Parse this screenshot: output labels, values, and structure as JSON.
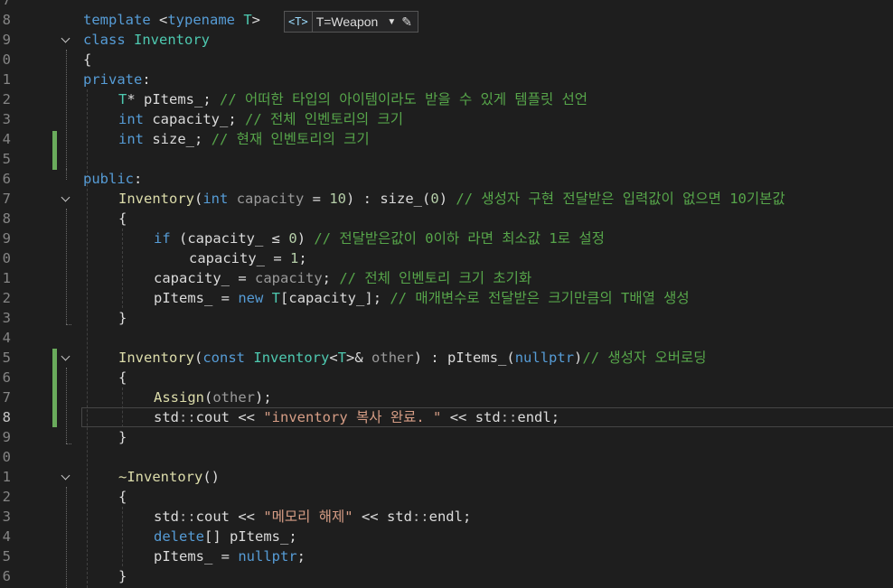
{
  "template_hint": {
    "tag": "<T>",
    "value": "T=Weapon",
    "dropdown_icon": "chevron-down-icon",
    "edit_icon": "pencil-icon"
  },
  "line_numbers": [
    "7",
    "8",
    "9",
    "0",
    "1",
    "2",
    "3",
    "4",
    "5",
    "6",
    "7",
    "8",
    "9",
    "0",
    "1",
    "2",
    "3",
    "4",
    "5",
    "6",
    "7",
    "8",
    "9",
    "0",
    "1",
    "2",
    "3",
    "4",
    "5",
    "6"
  ],
  "code": {
    "l8": [
      "template",
      " <",
      "typename",
      " ",
      "T",
      ">"
    ],
    "l9": [
      "class",
      " ",
      "Inventory"
    ],
    "l10": [
      "{"
    ],
    "l11": [
      "private",
      ":"
    ],
    "l12": [
      "T",
      "* ",
      "pItems_",
      "; ",
      "// 어떠한 타입의 아이템이라도 받을 수 있게 템플릿 선언"
    ],
    "l13": [
      "int",
      " ",
      "capacity_",
      "; ",
      "// 전체 인벤토리의 크기"
    ],
    "l14": [
      "int",
      " ",
      "size_",
      "; ",
      "// 현재 인벤토리의 크기"
    ],
    "l16": [
      "public",
      ":"
    ],
    "l17": [
      "Inventory",
      "(",
      "int",
      " ",
      "capacity",
      " = ",
      "10",
      ") : ",
      "size_",
      "(",
      "0",
      ") ",
      "// 생성자 구현 전달받은 입력값이 없으면 10기본값"
    ],
    "l18": [
      "{"
    ],
    "l19": [
      "if",
      " (",
      "capacity_",
      " ≤ ",
      "0",
      ") ",
      "// 전달받은값이 0이하 라면 최소값 1로 설정"
    ],
    "l20": [
      "capacity_",
      " = ",
      "1",
      ";"
    ],
    "l21": [
      "capacity_",
      " = ",
      "capacity",
      "; ",
      "// 전체 인벤토리 크기 초기화"
    ],
    "l22": [
      "pItems_",
      " = ",
      "new",
      " ",
      "T",
      "[",
      "capacity_",
      "]; ",
      "// 매개변수로 전달받은 크기만큼의 T배열 생성"
    ],
    "l23": [
      "}"
    ],
    "l25": [
      "Inventory",
      "(",
      "const",
      " ",
      "Inventory",
      "<",
      "T",
      ">& ",
      "other",
      ") : ",
      "pItems_",
      "(",
      "nullptr",
      ")",
      "// 생성자 오버로딩"
    ],
    "l26": [
      "{"
    ],
    "l27": [
      "Assign",
      "(",
      "other",
      ");"
    ],
    "l28": [
      "std",
      "::",
      "cout",
      " << ",
      "\"inventory 복사 완료. \"",
      " << ",
      "std",
      "::",
      "endl",
      ";"
    ],
    "l29": [
      "}"
    ],
    "l31": [
      "~",
      "Inventory",
      "()"
    ],
    "l32": [
      "{"
    ],
    "l33": [
      "std",
      "::",
      "cout",
      " << ",
      "\"메모리 해제\"",
      " << ",
      "std",
      "::",
      "endl",
      ";"
    ],
    "l34": [
      "delete",
      "[] ",
      "pItems_",
      ";"
    ],
    "l35": [
      "pItems_",
      " = ",
      "nullptr",
      ";"
    ],
    "l36": [
      "}"
    ]
  }
}
